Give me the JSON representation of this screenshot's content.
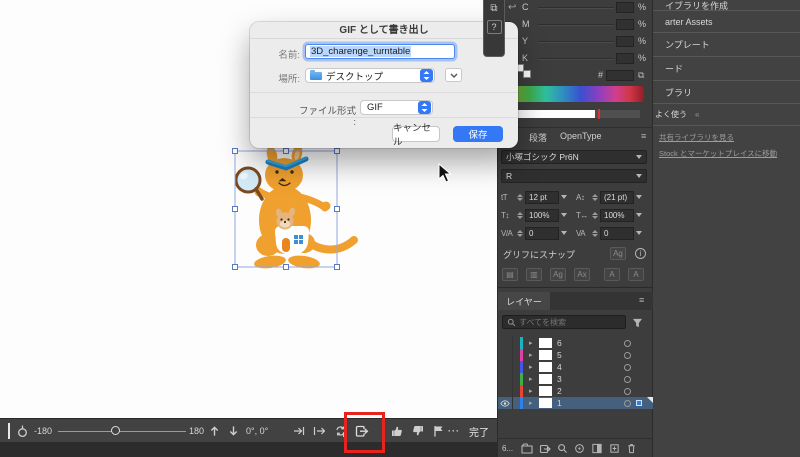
{
  "dialog": {
    "title": "GIF として書き出し",
    "name_label": "名前:",
    "name_value": "3D_charenge_turntable",
    "location_label": "場所:",
    "location_value": "デスクトップ",
    "format_label": "ファイル形式 :",
    "format_value": "GIF",
    "cancel_label": "キャンセル",
    "save_label": "保存"
  },
  "floating": {
    "help_label": "?",
    "window_glyph": "⧉",
    "undo_glyph": "↩"
  },
  "color_panel": {
    "channels": [
      "C",
      "M",
      "Y",
      "K"
    ],
    "percent": "%",
    "hex_label": "#",
    "copy_glyph": "⧉"
  },
  "char_panel": {
    "tabs": [
      "段落",
      "OpenType"
    ],
    "menu_glyph": "≡",
    "font_name": "小塚ゴシック Pr6N",
    "font_style": "R",
    "size_value": "12 pt",
    "leading_value": "(21 pt)",
    "vscale_value": "100%",
    "hscale_value": "100%",
    "kerning_value": "0",
    "tracking_value": "0",
    "icons": {
      "size": "tT",
      "leading": "A↕",
      "vscale": "T↕",
      "hscale": "T↔",
      "kerning": "V/A",
      "tracking": "VA"
    },
    "snap_label": "グリフにスナップ",
    "snap_badge": "Ag",
    "snap_row_icons": [
      "▤",
      "▥",
      "Ag",
      "Ax",
      "A",
      "A"
    ]
  },
  "layers_panel": {
    "tab": "レイヤー",
    "menu_glyph": "≡",
    "search_placeholder": "すべてを検索",
    "layers": [
      {
        "label": "6",
        "color": "#19b3c2"
      },
      {
        "label": "5",
        "color": "#e33fa8"
      },
      {
        "label": "4",
        "color": "#4556e0"
      },
      {
        "label": "3",
        "color": "#3fae49"
      },
      {
        "label": "2",
        "color": "#e8453a"
      },
      {
        "label": "1",
        "color": "#2f80e8"
      }
    ],
    "count_label": "6..."
  },
  "libraries": {
    "menu_items": [
      "イブラリを作成",
      "arter Assets",
      "ンプレート",
      "ード",
      "ブラリ",
      "よく使う"
    ],
    "collapse_glyph": "«",
    "links": [
      "共有ライブラリを見る",
      "Stock とマーケットプレイスに移動"
    ]
  },
  "bottom_bar": {
    "min": "-180",
    "max": "180",
    "angle": "0°, 0°",
    "more_glyph": "···",
    "done_label": "完了"
  },
  "colors": {
    "accent": "#3478f6",
    "highlight_red": "#e8231d"
  }
}
